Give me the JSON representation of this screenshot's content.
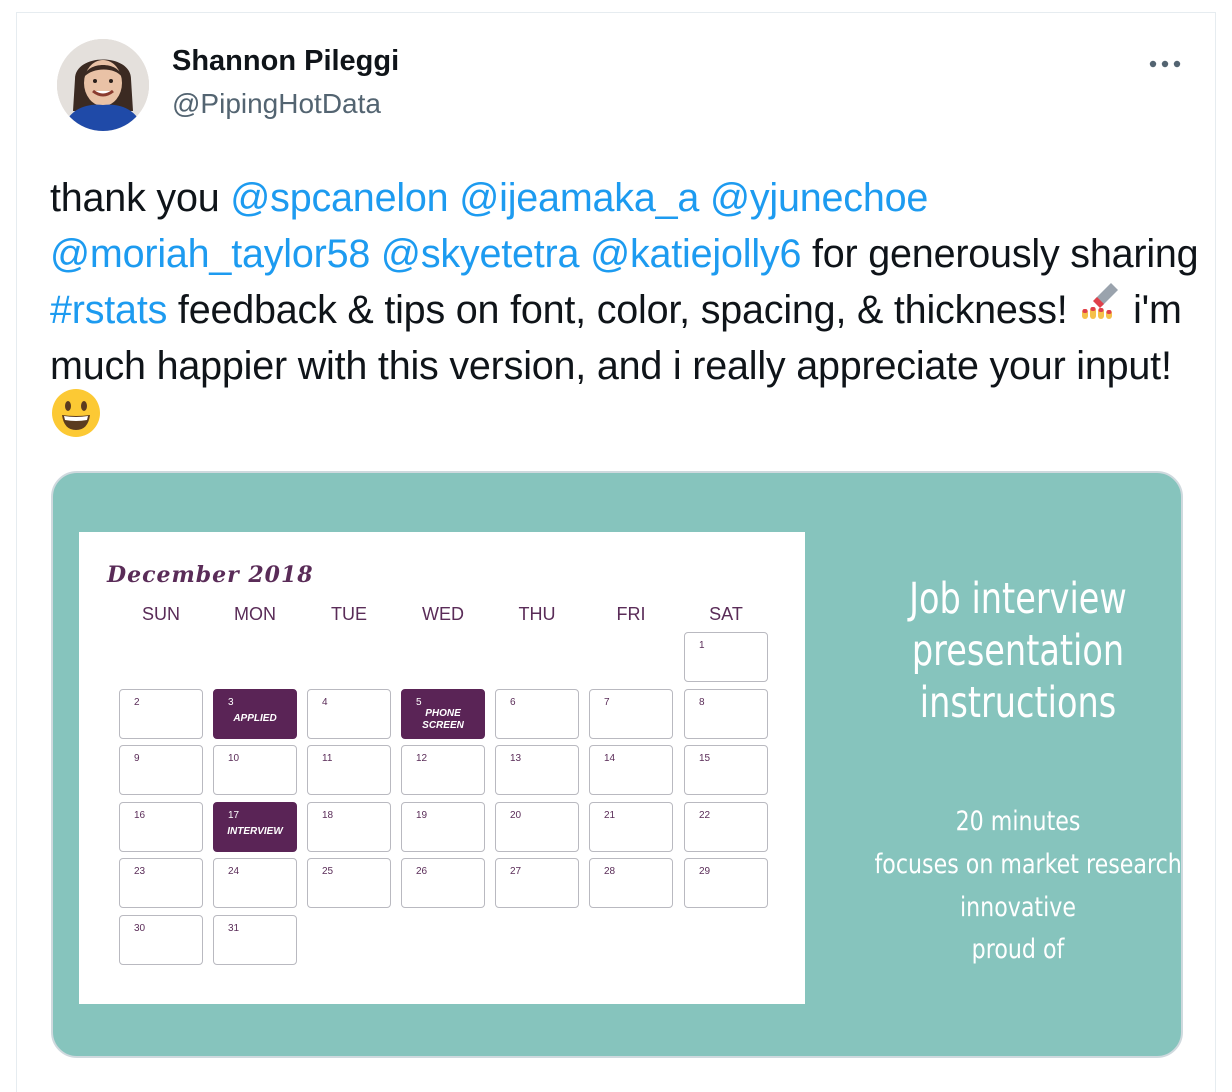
{
  "tweet": {
    "author_name": "Shannon Pileggi",
    "author_handle": "@PipingHotData",
    "more_icon": "more-horizontal-icon",
    "text": {
      "t1": "thank you ",
      "m1": "@spcanelon",
      "m2": "@ijeamaka_a",
      "m3": "@yjunechoe",
      "m4": "@moriah_taylor58",
      "m5": "@skyetetra",
      "m6": "@katiejolly6",
      "t2": " for generously sharing ",
      "hashtag": "#rstats",
      "t3": " feedback & tips on font, color, spacing, & thickness! ",
      "emoji1": "nail-polish-emoji",
      "t4": " i'm much happier with this version, and i really appreciate your input!",
      "emoji2": "grinning-face-emoji"
    }
  },
  "media": {
    "background": "#86c4bd",
    "calendar": {
      "title": "December 2018",
      "days_of_week": [
        "SUN",
        "MON",
        "TUE",
        "WED",
        "THU",
        "FRI",
        "SAT"
      ],
      "dates": [
        "1",
        "2",
        "3",
        "4",
        "5",
        "6",
        "7",
        "8",
        "9",
        "10",
        "11",
        "12",
        "13",
        "14",
        "15",
        "16",
        "17",
        "18",
        "19",
        "20",
        "21",
        "22",
        "23",
        "24",
        "25",
        "26",
        "27",
        "28",
        "29",
        "30",
        "31"
      ],
      "events": {
        "3": "APPLIED",
        "5": "PHONE SCREEN",
        "17": "INTERVIEW"
      },
      "event_color": "#5a2456"
    },
    "side_panel": {
      "title_lines": [
        "Job interview",
        "presentation",
        "instructions"
      ],
      "details": [
        "20 minutes",
        "focuses on market research",
        "innovative",
        "proud of"
      ]
    }
  }
}
